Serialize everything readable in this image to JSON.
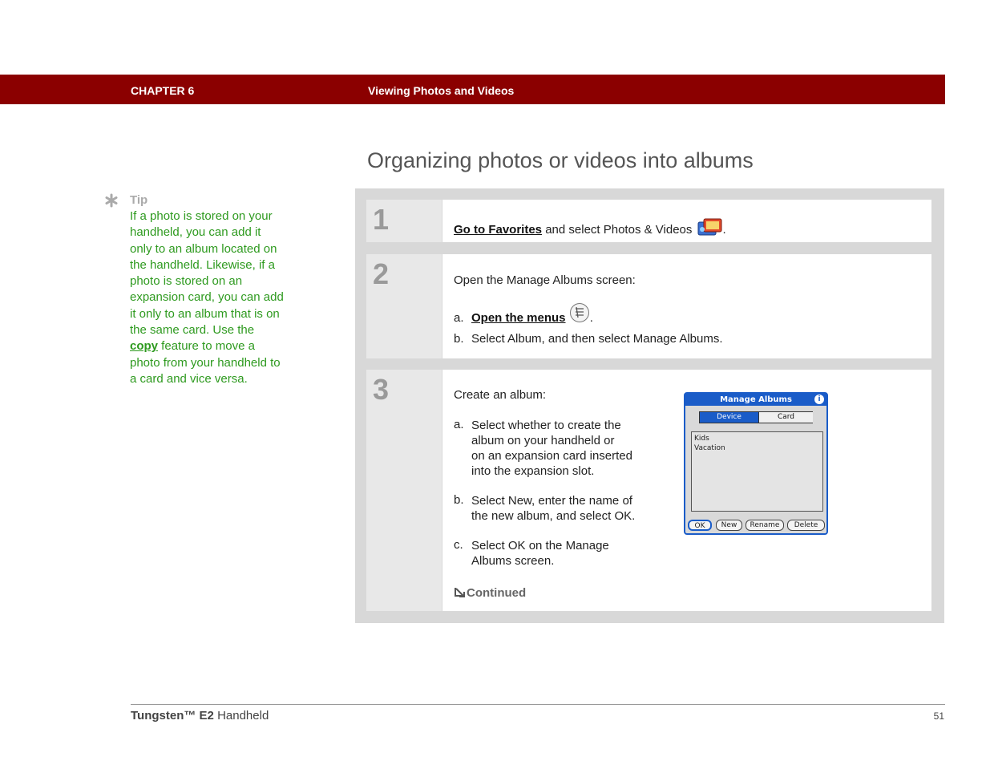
{
  "header": {
    "chapter": "CHAPTER 6",
    "title": "Viewing Photos and Videos",
    "bar_color": "#8b0000"
  },
  "page_title": "Organizing photos or videos into albums",
  "tip": {
    "label": "Tip",
    "icon": "asterisk-icon",
    "text_before": "If a photo is stored on your handheld, you can add it only to an album located on the handheld. Likewise, if a photo is stored on an expansion card, you can add it only to an album that is on the same card. Use the ",
    "link": "copy",
    "text_after": " feature to move a photo from your handheld to a card and vice versa.",
    "color": "#2e9a1f"
  },
  "steps": [
    {
      "number": "1",
      "link": "Go to Favorites",
      "text": " and select Photos & Videos ",
      "icon": "photos-videos-icon",
      "end": "."
    },
    {
      "number": "2",
      "intro": "Open the Manage Albums screen:",
      "a_letter": "a.",
      "a_link": "Open the menus",
      "a_icon": "menu-icon",
      "a_end": ".",
      "b_letter": "b.",
      "b_text": "Select Album, and then select Manage Albums."
    },
    {
      "number": "3",
      "intro": "Create an album:",
      "a_letter": "a.",
      "a_lines": [
        "Select whether to create the",
        "album on your handheld or",
        "on an expansion card inserted",
        "into the expansion slot."
      ],
      "b_letter": "b.",
      "b_lines": [
        "Select New, enter the name of",
        "the new album, and select OK."
      ],
      "c_letter": "c.",
      "c_lines": [
        "Select OK on the Manage",
        "Albums screen."
      ],
      "continued": "Continued",
      "continued_icon": "arrow-continued-icon"
    }
  ],
  "palm_screen": {
    "title": "Manage Albums",
    "info_icon": "info-icon",
    "tabs": [
      "Device",
      "Card"
    ],
    "selected_tab": "Device",
    "albums": [
      "Kids",
      "Vacation"
    ],
    "buttons": [
      "OK",
      "New",
      "Rename",
      "Delete"
    ],
    "accent": "#1a5cc8"
  },
  "footer": {
    "product_bold": "Tungsten™ E2",
    "product_rest": " Handheld",
    "page_number": "51"
  }
}
